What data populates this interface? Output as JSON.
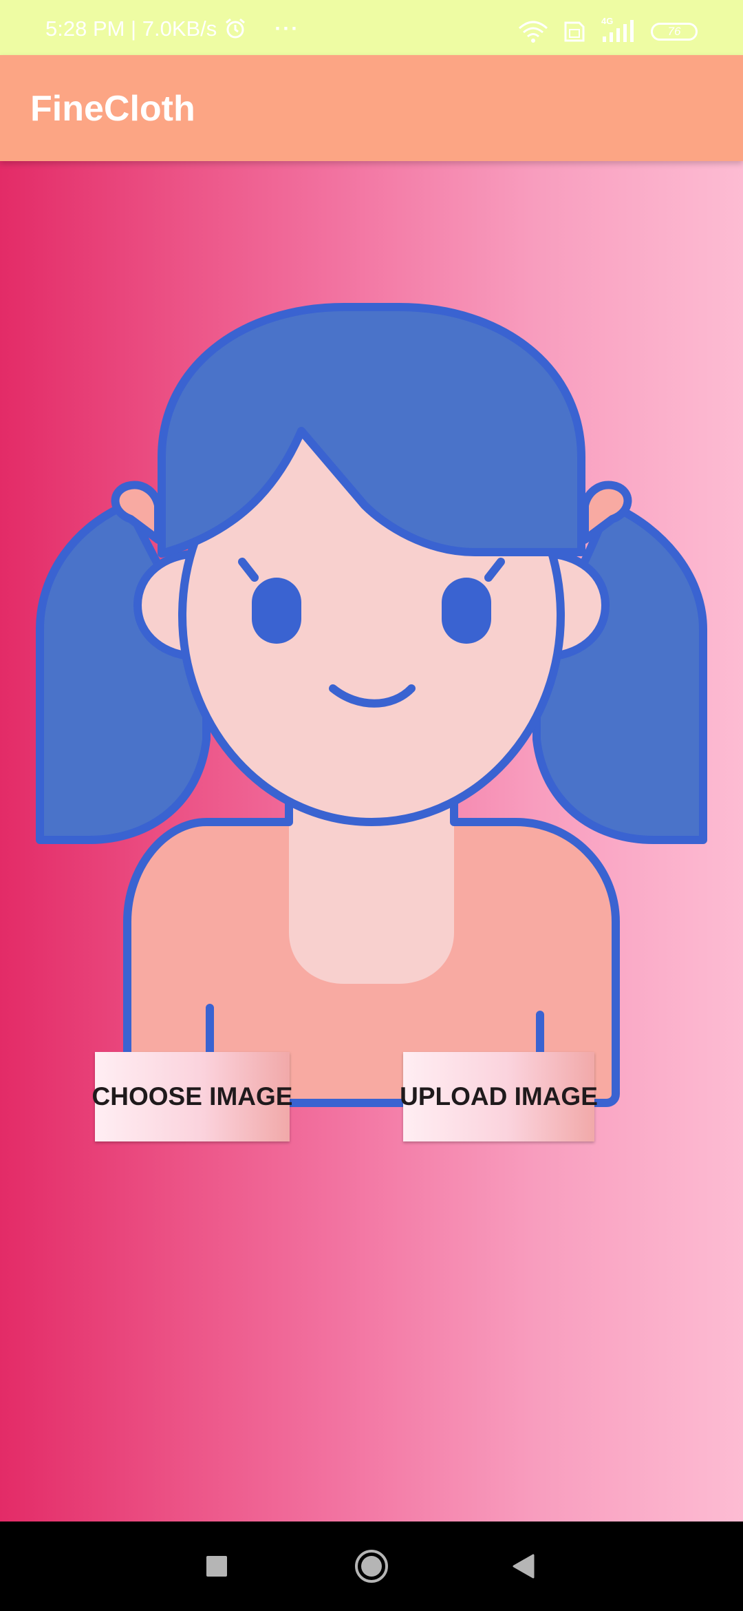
{
  "status_bar": {
    "time_and_speed": "5:28 PM | 7.0KB/s",
    "more_indicator": "···",
    "network_label": "4G",
    "battery_level": "76",
    "icons": [
      "alarm-icon",
      "wifi-icon",
      "sim-card-icon",
      "cellular-signal-icon",
      "battery-icon"
    ]
  },
  "app_bar": {
    "title": "FineCloth",
    "color": "#fca584"
  },
  "main": {
    "avatar_icon": "girl-avatar-icon",
    "gradient": [
      "#e32b67",
      "#fdbcd3"
    ],
    "buttons": {
      "choose_label": "CHOOSE IMAGE",
      "upload_label": "UPLOAD IMAGE"
    }
  },
  "nav_bar": {
    "icons": [
      "recents-square-icon",
      "home-circle-icon",
      "back-triangle-icon"
    ]
  }
}
